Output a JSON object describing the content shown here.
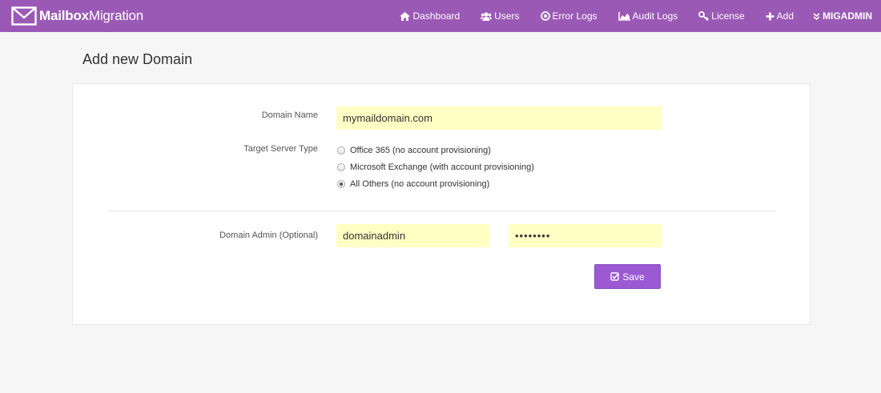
{
  "brand": {
    "name_bold": "Mailbox",
    "name_rest": "Migration",
    "icon": "envelope-icon"
  },
  "nav": {
    "items": [
      {
        "label": "Dashboard",
        "icon": "home-icon"
      },
      {
        "label": "Users",
        "icon": "users-icon"
      },
      {
        "label": "Error Logs",
        "icon": "error-circle-icon"
      },
      {
        "label": "Audit Logs",
        "icon": "area-chart-icon"
      },
      {
        "label": "License",
        "icon": "key-icon"
      },
      {
        "label": "Add",
        "icon": "plus-icon"
      }
    ],
    "user": {
      "label": "MIGADMIN",
      "icon": "double-chevron-down-icon"
    }
  },
  "page": {
    "title": "Add new Domain"
  },
  "form": {
    "domain_name": {
      "label": "Domain Name",
      "value": "mymaildomain.com"
    },
    "server_type": {
      "label": "Target Server Type",
      "options": [
        {
          "label": "Office 365 (no account provisioning)",
          "checked": false
        },
        {
          "label": "Microsoft Exchange (with account provisioning)",
          "checked": false
        },
        {
          "label": "All Others (no account provisioning)",
          "checked": true
        }
      ]
    },
    "domain_admin": {
      "label": "Domain Admin (Optional)",
      "username": "domainadmin",
      "password": "••••••••"
    },
    "save_label": "Save"
  },
  "colors": {
    "navbar": "#9b59b6",
    "field_bg": "#ffffc4",
    "button": "#9b59d3",
    "page_bg": "#f6f6f6"
  }
}
